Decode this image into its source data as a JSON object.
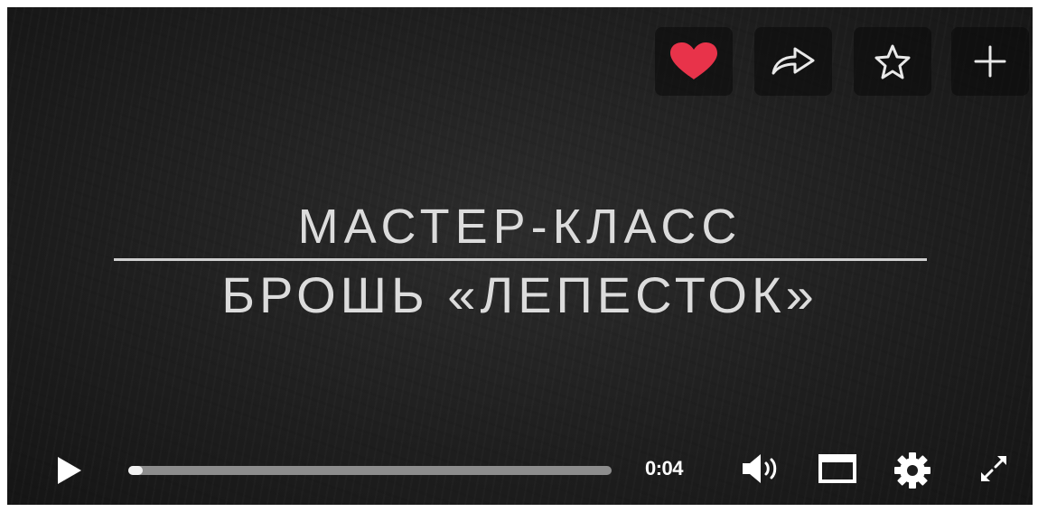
{
  "video": {
    "title_line1": "МАСТЕР-КЛАСС",
    "title_line2": "БРОШЬ «ЛЕПЕСТОК»"
  },
  "actions": {
    "like_icon": "heart-icon",
    "share_icon": "share-arrow-icon",
    "favorite_icon": "star-icon",
    "add_icon": "plus-icon",
    "like_color": "#e8334a"
  },
  "player": {
    "play_icon": "play-icon",
    "current_time": "0:04",
    "progress_fraction": 0.03,
    "volume_icon": "speaker-icon",
    "miniplayer_icon": "window-icon",
    "settings_icon": "gear-icon",
    "fullscreen_icon": "expand-icon"
  }
}
